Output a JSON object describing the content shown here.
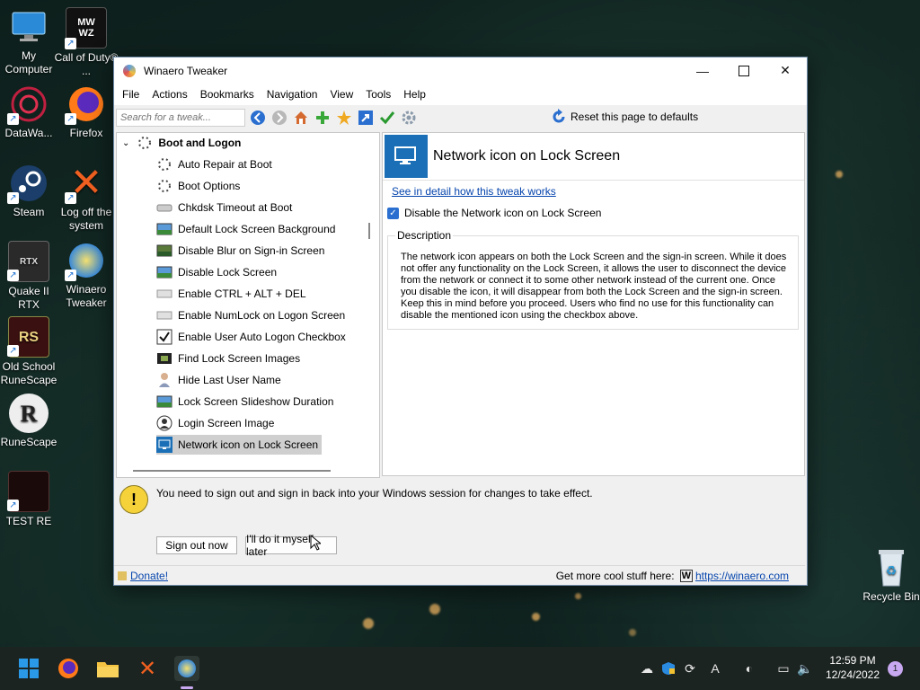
{
  "desktop": {
    "icons": [
      {
        "label": "My Computer"
      },
      {
        "label": "Call of Duty® ..."
      },
      {
        "label": "DataWa..."
      },
      {
        "label": "Firefox"
      },
      {
        "label": "Steam"
      },
      {
        "label": "Log off the system"
      },
      {
        "label": "Quake II RTX"
      },
      {
        "label": "Winaero Tweaker"
      },
      {
        "label": "Old School RuneScape"
      },
      {
        "label": "RuneScape"
      },
      {
        "label": "TEST RE"
      },
      {
        "label": "Recycle Bin"
      }
    ]
  },
  "window": {
    "title": "Winaero Tweaker",
    "menu": [
      "File",
      "Actions",
      "Bookmarks",
      "Navigation",
      "View",
      "Tools",
      "Help"
    ],
    "search_placeholder": "Search for a tweak...",
    "reset_label": "Reset this page to defaults",
    "tree": {
      "category": "Boot and Logon",
      "items": [
        {
          "label": "Auto Repair at Boot",
          "icon": "spinner-icon"
        },
        {
          "label": "Boot Options",
          "icon": "spinner-icon"
        },
        {
          "label": "Chkdsk Timeout at Boot",
          "icon": "drive-icon"
        },
        {
          "label": "Default Lock Screen Background",
          "icon": "landscape-icon"
        },
        {
          "label": "Disable Blur on Sign-in Screen",
          "icon": "landscape-icon"
        },
        {
          "label": "Disable Lock Screen",
          "icon": "landscape-icon"
        },
        {
          "label": "Enable CTRL + ALT + DEL",
          "icon": "keyboard-icon"
        },
        {
          "label": "Enable NumLock on Logon Screen",
          "icon": "keyboard-icon"
        },
        {
          "label": "Enable User Auto Logon Checkbox",
          "icon": "checkbox-icon"
        },
        {
          "label": "Find Lock Screen Images",
          "icon": "images-icon"
        },
        {
          "label": "Hide Last User Name",
          "icon": "user-icon"
        },
        {
          "label": "Lock Screen Slideshow Duration",
          "icon": "landscape-icon"
        },
        {
          "label": "Login Screen Image",
          "icon": "user-circle-icon"
        },
        {
          "label": "Network icon on Lock Screen",
          "icon": "monitor-icon"
        }
      ],
      "selected": "Network icon on Lock Screen"
    },
    "panel": {
      "title": "Network icon on Lock Screen",
      "detail_link": "See in detail how this tweak works",
      "checkbox_label": "Disable the Network icon on Lock Screen",
      "checkbox_checked": true,
      "description_legend": "Description",
      "description": "The network icon appears on both the Lock Screen and the sign-in screen. While it does not offer any functionality on the Lock Screen, it allows the user to disconnect the device from the network or connect it to some other network instead of the current one. Once you disable the icon, it will disappear from both the Lock Screen and the sign-in screen. Keep this in mind before you proceed. Users who find no use for this functionality can disable the mentioned icon using the checkbox above."
    },
    "notice": "You need to sign out and sign in back into your Windows session for changes to take effect.",
    "buttons": {
      "sign_out": "Sign out now",
      "later": "I'll do it myself later"
    },
    "status": {
      "donate": "Donate!",
      "more": "Get more cool stuff here:",
      "url": "https://winaero.com"
    }
  },
  "taskbar": {
    "time": "12:59 PM",
    "date": "12/24/2022",
    "notification_count": "1"
  },
  "colors": {
    "accent": "#1a6fb6",
    "link": "#0645ad",
    "taskbar": "#1c2421"
  }
}
